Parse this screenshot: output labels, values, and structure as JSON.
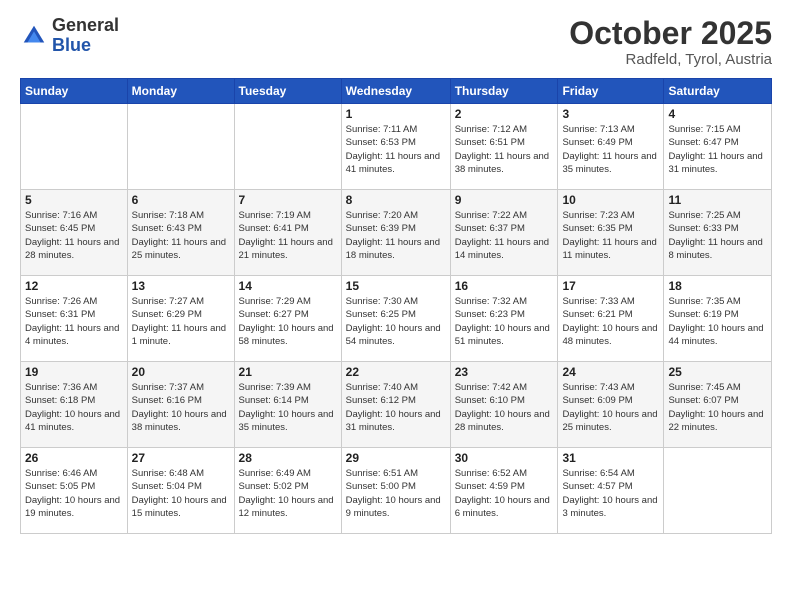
{
  "header": {
    "logo_general": "General",
    "logo_blue": "Blue",
    "month_title": "October 2025",
    "location": "Radfeld, Tyrol, Austria"
  },
  "days_of_week": [
    "Sunday",
    "Monday",
    "Tuesday",
    "Wednesday",
    "Thursday",
    "Friday",
    "Saturday"
  ],
  "weeks": [
    [
      {
        "day": "",
        "info": ""
      },
      {
        "day": "",
        "info": ""
      },
      {
        "day": "",
        "info": ""
      },
      {
        "day": "1",
        "info": "Sunrise: 7:11 AM\nSunset: 6:53 PM\nDaylight: 11 hours and 41 minutes."
      },
      {
        "day": "2",
        "info": "Sunrise: 7:12 AM\nSunset: 6:51 PM\nDaylight: 11 hours and 38 minutes."
      },
      {
        "day": "3",
        "info": "Sunrise: 7:13 AM\nSunset: 6:49 PM\nDaylight: 11 hours and 35 minutes."
      },
      {
        "day": "4",
        "info": "Sunrise: 7:15 AM\nSunset: 6:47 PM\nDaylight: 11 hours and 31 minutes."
      }
    ],
    [
      {
        "day": "5",
        "info": "Sunrise: 7:16 AM\nSunset: 6:45 PM\nDaylight: 11 hours and 28 minutes."
      },
      {
        "day": "6",
        "info": "Sunrise: 7:18 AM\nSunset: 6:43 PM\nDaylight: 11 hours and 25 minutes."
      },
      {
        "day": "7",
        "info": "Sunrise: 7:19 AM\nSunset: 6:41 PM\nDaylight: 11 hours and 21 minutes."
      },
      {
        "day": "8",
        "info": "Sunrise: 7:20 AM\nSunset: 6:39 PM\nDaylight: 11 hours and 18 minutes."
      },
      {
        "day": "9",
        "info": "Sunrise: 7:22 AM\nSunset: 6:37 PM\nDaylight: 11 hours and 14 minutes."
      },
      {
        "day": "10",
        "info": "Sunrise: 7:23 AM\nSunset: 6:35 PM\nDaylight: 11 hours and 11 minutes."
      },
      {
        "day": "11",
        "info": "Sunrise: 7:25 AM\nSunset: 6:33 PM\nDaylight: 11 hours and 8 minutes."
      }
    ],
    [
      {
        "day": "12",
        "info": "Sunrise: 7:26 AM\nSunset: 6:31 PM\nDaylight: 11 hours and 4 minutes."
      },
      {
        "day": "13",
        "info": "Sunrise: 7:27 AM\nSunset: 6:29 PM\nDaylight: 11 hours and 1 minute."
      },
      {
        "day": "14",
        "info": "Sunrise: 7:29 AM\nSunset: 6:27 PM\nDaylight: 10 hours and 58 minutes."
      },
      {
        "day": "15",
        "info": "Sunrise: 7:30 AM\nSunset: 6:25 PM\nDaylight: 10 hours and 54 minutes."
      },
      {
        "day": "16",
        "info": "Sunrise: 7:32 AM\nSunset: 6:23 PM\nDaylight: 10 hours and 51 minutes."
      },
      {
        "day": "17",
        "info": "Sunrise: 7:33 AM\nSunset: 6:21 PM\nDaylight: 10 hours and 48 minutes."
      },
      {
        "day": "18",
        "info": "Sunrise: 7:35 AM\nSunset: 6:19 PM\nDaylight: 10 hours and 44 minutes."
      }
    ],
    [
      {
        "day": "19",
        "info": "Sunrise: 7:36 AM\nSunset: 6:18 PM\nDaylight: 10 hours and 41 minutes."
      },
      {
        "day": "20",
        "info": "Sunrise: 7:37 AM\nSunset: 6:16 PM\nDaylight: 10 hours and 38 minutes."
      },
      {
        "day": "21",
        "info": "Sunrise: 7:39 AM\nSunset: 6:14 PM\nDaylight: 10 hours and 35 minutes."
      },
      {
        "day": "22",
        "info": "Sunrise: 7:40 AM\nSunset: 6:12 PM\nDaylight: 10 hours and 31 minutes."
      },
      {
        "day": "23",
        "info": "Sunrise: 7:42 AM\nSunset: 6:10 PM\nDaylight: 10 hours and 28 minutes."
      },
      {
        "day": "24",
        "info": "Sunrise: 7:43 AM\nSunset: 6:09 PM\nDaylight: 10 hours and 25 minutes."
      },
      {
        "day": "25",
        "info": "Sunrise: 7:45 AM\nSunset: 6:07 PM\nDaylight: 10 hours and 22 minutes."
      }
    ],
    [
      {
        "day": "26",
        "info": "Sunrise: 6:46 AM\nSunset: 5:05 PM\nDaylight: 10 hours and 19 minutes."
      },
      {
        "day": "27",
        "info": "Sunrise: 6:48 AM\nSunset: 5:04 PM\nDaylight: 10 hours and 15 minutes."
      },
      {
        "day": "28",
        "info": "Sunrise: 6:49 AM\nSunset: 5:02 PM\nDaylight: 10 hours and 12 minutes."
      },
      {
        "day": "29",
        "info": "Sunrise: 6:51 AM\nSunset: 5:00 PM\nDaylight: 10 hours and 9 minutes."
      },
      {
        "day": "30",
        "info": "Sunrise: 6:52 AM\nSunset: 4:59 PM\nDaylight: 10 hours and 6 minutes."
      },
      {
        "day": "31",
        "info": "Sunrise: 6:54 AM\nSunset: 4:57 PM\nDaylight: 10 hours and 3 minutes."
      },
      {
        "day": "",
        "info": ""
      }
    ]
  ]
}
